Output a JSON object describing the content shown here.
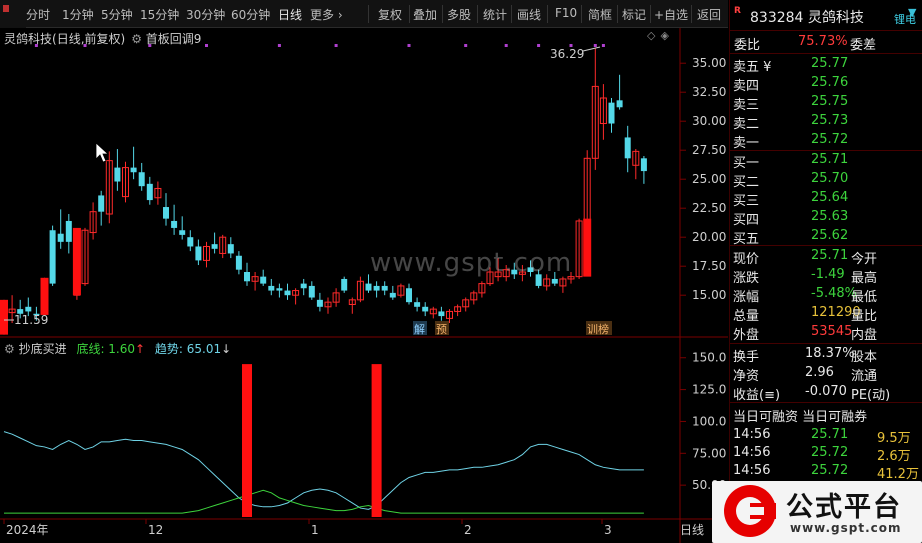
{
  "toolbar": {
    "timeframes": [
      "分时",
      "1分钟",
      "5分钟",
      "15分钟",
      "30分钟",
      "60分钟",
      "日线",
      "更多 ›"
    ],
    "active": "日线",
    "buttons": [
      "复权",
      "叠加",
      "多股",
      "统计",
      "画线",
      "F10",
      "简框",
      "标记",
      "+自选",
      "返回"
    ]
  },
  "chart_info": {
    "stock_name": "灵鸽科技",
    "mode": "(日线,前复权)",
    "formula": "首板回调9"
  },
  "price_chart": {
    "ytick_labels": [
      "35.00",
      "32.50",
      "30.00",
      "27.50",
      "25.00",
      "22.50",
      "20.00",
      "17.50",
      "15.00"
    ],
    "ytick_values": [
      35,
      32.5,
      30,
      27.5,
      25,
      22.5,
      20,
      17.5,
      15
    ],
    "high_label": "36.29",
    "low_label": "11.59",
    "markers": [
      "解",
      "预",
      "训榜"
    ]
  },
  "indicator": {
    "name": "抄底买进",
    "line1_label": "底线: 1.60",
    "line2_label": "趋势: 65.01",
    "ytick_labels": [
      "150.0",
      "125.0",
      "100.0",
      "75.00",
      "50.00"
    ],
    "ytick_values": [
      150,
      125,
      100,
      75,
      50
    ]
  },
  "xaxis": {
    "labels": [
      "2024年",
      "12",
      "1",
      "2",
      "3"
    ],
    "tab": "日线"
  },
  "quote": {
    "code": "833284",
    "name": "灵鸽科技",
    "side_label": "锂电",
    "weibi_label": "委比",
    "weibi_value": "75.73%",
    "weicha_label": "委差",
    "asks": [
      {
        "label": "卖五 ¥",
        "price": "25.77"
      },
      {
        "label": "卖四",
        "price": "25.76"
      },
      {
        "label": "卖三",
        "price": "25.75"
      },
      {
        "label": "卖二",
        "price": "25.73"
      },
      {
        "label": "卖一",
        "price": "25.72"
      }
    ],
    "bids": [
      {
        "label": "买一",
        "price": "25.71"
      },
      {
        "label": "买二",
        "price": "25.70"
      },
      {
        "label": "买三",
        "price": "25.64"
      },
      {
        "label": "买四",
        "price": "25.63"
      },
      {
        "label": "买五",
        "price": "25.62"
      }
    ],
    "stats": [
      {
        "l1": "现价",
        "v1": "25.71",
        "c1": "green",
        "l2": "今开"
      },
      {
        "l1": "涨跌",
        "v1": "-1.49",
        "c1": "green",
        "l2": "最高"
      },
      {
        "l1": "涨幅",
        "v1": "-5.48%",
        "c1": "green",
        "l2": "最低"
      },
      {
        "l1": "总量",
        "v1": "121290",
        "c1": "yel",
        "l2": "量比"
      },
      {
        "l1": "外盘",
        "v1": "53545",
        "c1": "red",
        "l2": "内盘"
      }
    ],
    "stats2": [
      {
        "l1": "换手",
        "v1": "18.37%",
        "l2": "股本"
      },
      {
        "l1": "净资",
        "v1": "2.96",
        "l2": "流通"
      },
      {
        "l1": "收益(≡)",
        "v1": "-0.070",
        "l2": "PE(动)"
      }
    ],
    "margin_title": "当日可融资  当日可融券",
    "ticks": [
      {
        "time": "14:56",
        "price": "25.71",
        "vol": "9.5万"
      },
      {
        "time": "14:56",
        "price": "25.72",
        "vol": "2.6万"
      },
      {
        "time": "14:56",
        "price": "25.72",
        "vol": "41.2万"
      }
    ]
  },
  "brand": {
    "title": "公式平台",
    "url": "www.gspt.com",
    "watermark": "www.gspt.com"
  },
  "chart_data": [
    {
      "type": "candlestick",
      "title": "",
      "ylim": [
        12,
        37
      ],
      "candles": [
        {
          "o": 13.0,
          "h": 14.6,
          "l": 11.6,
          "c": 14.2,
          "up": false
        },
        {
          "o": 13.5,
          "h": 15.0,
          "l": 12.6,
          "c": 13.8,
          "up": true
        },
        {
          "o": 13.8,
          "h": 14.6,
          "l": 13.0,
          "c": 13.4,
          "up": false
        },
        {
          "o": 13.6,
          "h": 14.8,
          "l": 13.2,
          "c": 14.0,
          "up": false
        },
        {
          "o": 13.4,
          "h": 14.0,
          "l": 12.8,
          "c": 13.3,
          "up": false
        },
        {
          "o": 13.5,
          "h": 16.5,
          "l": 13.3,
          "c": 16.3,
          "up": true
        },
        {
          "o": 16.0,
          "h": 21.0,
          "l": 15.8,
          "c": 20.6,
          "up": false
        },
        {
          "o": 20.3,
          "h": 22.4,
          "l": 19.0,
          "c": 19.6,
          "up": false
        },
        {
          "o": 19.6,
          "h": 22.0,
          "l": 18.6,
          "c": 21.4,
          "up": false
        },
        {
          "o": 15.0,
          "h": 16.2,
          "l": 14.6,
          "c": 15.8,
          "up": true
        },
        {
          "o": 16.0,
          "h": 20.8,
          "l": 15.8,
          "c": 20.6,
          "up": true
        },
        {
          "o": 20.4,
          "h": 23.0,
          "l": 19.8,
          "c": 22.2,
          "up": true
        },
        {
          "o": 22.2,
          "h": 24.0,
          "l": 21.0,
          "c": 23.6,
          "up": false
        },
        {
          "o": 22.0,
          "h": 27.4,
          "l": 21.2,
          "c": 26.6,
          "up": true
        },
        {
          "o": 26.0,
          "h": 27.6,
          "l": 24.0,
          "c": 24.8,
          "up": false
        },
        {
          "o": 23.5,
          "h": 26.5,
          "l": 23.0,
          "c": 26.0,
          "up": true
        },
        {
          "o": 26.0,
          "h": 27.8,
          "l": 25.0,
          "c": 25.6,
          "up": false
        },
        {
          "o": 25.6,
          "h": 26.4,
          "l": 24.0,
          "c": 24.4,
          "up": false
        },
        {
          "o": 24.6,
          "h": 25.2,
          "l": 22.8,
          "c": 23.2,
          "up": false
        },
        {
          "o": 23.4,
          "h": 24.8,
          "l": 22.8,
          "c": 24.2,
          "up": true
        },
        {
          "o": 22.6,
          "h": 23.8,
          "l": 21.0,
          "c": 21.6,
          "up": false
        },
        {
          "o": 21.4,
          "h": 22.8,
          "l": 20.2,
          "c": 20.8,
          "up": false
        },
        {
          "o": 20.6,
          "h": 21.8,
          "l": 19.8,
          "c": 20.2,
          "up": false
        },
        {
          "o": 20.0,
          "h": 20.6,
          "l": 18.8,
          "c": 19.2,
          "up": false
        },
        {
          "o": 19.2,
          "h": 19.8,
          "l": 17.6,
          "c": 18.0,
          "up": false
        },
        {
          "o": 18.0,
          "h": 19.6,
          "l": 17.4,
          "c": 19.2,
          "up": true
        },
        {
          "o": 19.4,
          "h": 20.4,
          "l": 18.6,
          "c": 19.0,
          "up": false
        },
        {
          "o": 18.6,
          "h": 20.2,
          "l": 18.2,
          "c": 20.0,
          "up": true
        },
        {
          "o": 19.4,
          "h": 20.0,
          "l": 18.2,
          "c": 18.6,
          "up": false
        },
        {
          "o": 18.4,
          "h": 18.8,
          "l": 16.8,
          "c": 17.2,
          "up": false
        },
        {
          "o": 17.0,
          "h": 17.8,
          "l": 15.8,
          "c": 16.2,
          "up": false
        },
        {
          "o": 16.2,
          "h": 17.0,
          "l": 15.4,
          "c": 16.6,
          "up": true
        },
        {
          "o": 16.6,
          "h": 17.2,
          "l": 15.8,
          "c": 16.0,
          "up": false
        },
        {
          "o": 15.8,
          "h": 16.4,
          "l": 15.0,
          "c": 15.4,
          "up": false
        },
        {
          "o": 15.4,
          "h": 16.0,
          "l": 14.8,
          "c": 15.6,
          "up": false
        },
        {
          "o": 15.4,
          "h": 16.0,
          "l": 14.6,
          "c": 15.0,
          "up": false
        },
        {
          "o": 15.0,
          "h": 15.6,
          "l": 14.2,
          "c": 15.4,
          "up": true
        },
        {
          "o": 15.6,
          "h": 16.4,
          "l": 15.0,
          "c": 16.0,
          "up": false
        },
        {
          "o": 15.8,
          "h": 16.2,
          "l": 14.6,
          "c": 14.8,
          "up": false
        },
        {
          "o": 14.6,
          "h": 15.2,
          "l": 13.6,
          "c": 14.0,
          "up": false
        },
        {
          "o": 14.0,
          "h": 14.8,
          "l": 13.4,
          "c": 14.4,
          "up": true
        },
        {
          "o": 14.4,
          "h": 15.6,
          "l": 14.0,
          "c": 15.2,
          "up": true
        },
        {
          "o": 15.4,
          "h": 16.6,
          "l": 15.2,
          "c": 16.4,
          "up": false
        },
        {
          "o": 14.2,
          "h": 14.8,
          "l": 13.4,
          "c": 14.6,
          "up": true
        },
        {
          "o": 14.6,
          "h": 16.6,
          "l": 14.4,
          "c": 16.2,
          "up": true
        },
        {
          "o": 16.0,
          "h": 16.8,
          "l": 15.2,
          "c": 15.4,
          "up": false
        },
        {
          "o": 15.4,
          "h": 16.2,
          "l": 14.8,
          "c": 15.8,
          "up": false
        },
        {
          "o": 15.8,
          "h": 16.2,
          "l": 15.0,
          "c": 15.4,
          "up": false
        },
        {
          "o": 15.2,
          "h": 15.8,
          "l": 14.6,
          "c": 14.8,
          "up": false
        },
        {
          "o": 15.0,
          "h": 16.0,
          "l": 14.8,
          "c": 15.8,
          "up": true
        },
        {
          "o": 15.6,
          "h": 16.0,
          "l": 14.2,
          "c": 14.4,
          "up": false
        },
        {
          "o": 14.4,
          "h": 14.8,
          "l": 13.6,
          "c": 14.0,
          "up": false
        },
        {
          "o": 14.0,
          "h": 14.4,
          "l": 13.2,
          "c": 13.6,
          "up": false
        },
        {
          "o": 13.4,
          "h": 14.0,
          "l": 13.0,
          "c": 13.8,
          "up": true
        },
        {
          "o": 13.6,
          "h": 14.0,
          "l": 12.8,
          "c": 13.2,
          "up": false
        },
        {
          "o": 13.0,
          "h": 13.8,
          "l": 12.6,
          "c": 13.6,
          "up": true
        },
        {
          "o": 13.6,
          "h": 14.2,
          "l": 13.2,
          "c": 14.0,
          "up": true
        },
        {
          "o": 14.0,
          "h": 14.8,
          "l": 13.6,
          "c": 14.6,
          "up": true
        },
        {
          "o": 14.6,
          "h": 15.4,
          "l": 14.2,
          "c": 15.2,
          "up": true
        },
        {
          "o": 15.2,
          "h": 16.2,
          "l": 14.8,
          "c": 16.0,
          "up": true
        },
        {
          "o": 16.0,
          "h": 17.4,
          "l": 15.8,
          "c": 17.0,
          "up": true
        },
        {
          "o": 17.0,
          "h": 18.2,
          "l": 16.2,
          "c": 16.6,
          "up": true
        },
        {
          "o": 16.6,
          "h": 17.6,
          "l": 16.2,
          "c": 17.2,
          "up": true
        },
        {
          "o": 17.2,
          "h": 17.8,
          "l": 16.4,
          "c": 16.8,
          "up": false
        },
        {
          "o": 16.8,
          "h": 17.6,
          "l": 16.2,
          "c": 17.0,
          "up": true
        },
        {
          "o": 17.0,
          "h": 18.0,
          "l": 16.6,
          "c": 17.4,
          "up": false
        },
        {
          "o": 16.8,
          "h": 17.2,
          "l": 15.6,
          "c": 15.8,
          "up": false
        },
        {
          "o": 15.8,
          "h": 16.8,
          "l": 15.4,
          "c": 16.4,
          "up": true
        },
        {
          "o": 16.4,
          "h": 17.0,
          "l": 15.8,
          "c": 16.0,
          "up": false
        },
        {
          "o": 15.8,
          "h": 16.6,
          "l": 15.2,
          "c": 16.4,
          "up": true
        },
        {
          "o": 16.4,
          "h": 17.0,
          "l": 16.0,
          "c": 16.6,
          "up": true
        },
        {
          "o": 16.6,
          "h": 21.6,
          "l": 16.4,
          "c": 21.4,
          "up": true
        },
        {
          "o": 19.0,
          "h": 27.5,
          "l": 18.6,
          "c": 26.8,
          "up": true
        },
        {
          "o": 26.8,
          "h": 36.3,
          "l": 25.8,
          "c": 33.0,
          "up": true
        },
        {
          "o": 32.0,
          "h": 33.2,
          "l": 28.4,
          "c": 29.8,
          "up": true
        },
        {
          "o": 29.8,
          "h": 32.0,
          "l": 29.0,
          "c": 31.6,
          "up": false
        },
        {
          "o": 31.8,
          "h": 34.0,
          "l": 31.0,
          "c": 31.2,
          "up": false
        },
        {
          "o": 28.6,
          "h": 29.6,
          "l": 25.6,
          "c": 26.8,
          "up": false
        },
        {
          "o": 26.2,
          "h": 27.6,
          "l": 25.0,
          "c": 27.4,
          "up": true
        },
        {
          "o": 26.8,
          "h": 27.0,
          "l": 24.6,
          "c": 25.7,
          "up": false
        }
      ]
    },
    {
      "type": "line",
      "title": "",
      "ylim": [
        25,
        160
      ],
      "bars": [
        {
          "i": 30,
          "v": 145
        },
        {
          "i": 46,
          "v": 145
        }
      ],
      "series": [
        {
          "name": "趋势",
          "color": "#6fd3e6",
          "values": [
            92,
            90,
            87,
            84,
            81,
            80,
            78,
            82,
            85,
            82,
            78,
            80,
            84,
            84,
            85,
            86,
            85,
            85,
            84,
            83,
            82,
            80,
            78,
            74,
            70,
            64,
            58,
            52,
            46,
            40,
            36,
            34,
            33,
            33,
            34,
            36,
            40,
            44,
            46,
            47,
            46,
            44,
            40,
            36,
            32,
            31,
            34,
            40,
            46,
            52,
            56,
            58,
            60,
            60,
            61,
            62,
            62,
            63,
            64,
            64,
            65,
            66,
            68,
            70,
            74,
            80,
            82,
            82,
            80,
            78,
            76,
            74,
            70,
            66,
            64,
            63,
            62,
            62,
            62,
            62
          ]
        },
        {
          "name": "底线",
          "color": "#3dd43d",
          "values": [
            28,
            28,
            28,
            28,
            28,
            28,
            28,
            28,
            28,
            28,
            28,
            28,
            28,
            28,
            28,
            28,
            28,
            28,
            28,
            28,
            28,
            28,
            28,
            29,
            30,
            32,
            34,
            36,
            38,
            40,
            42,
            44,
            46,
            44,
            40,
            38,
            36,
            34,
            33,
            32,
            31,
            30,
            30,
            31,
            33,
            34,
            32,
            30,
            29,
            28,
            28,
            28,
            28,
            28,
            28,
            28,
            28,
            28,
            28,
            28,
            28,
            28,
            28,
            28,
            28,
            28,
            28,
            28,
            28,
            28,
            28,
            28,
            28,
            28,
            28,
            28,
            28,
            28,
            28,
            28
          ]
        }
      ]
    }
  ]
}
